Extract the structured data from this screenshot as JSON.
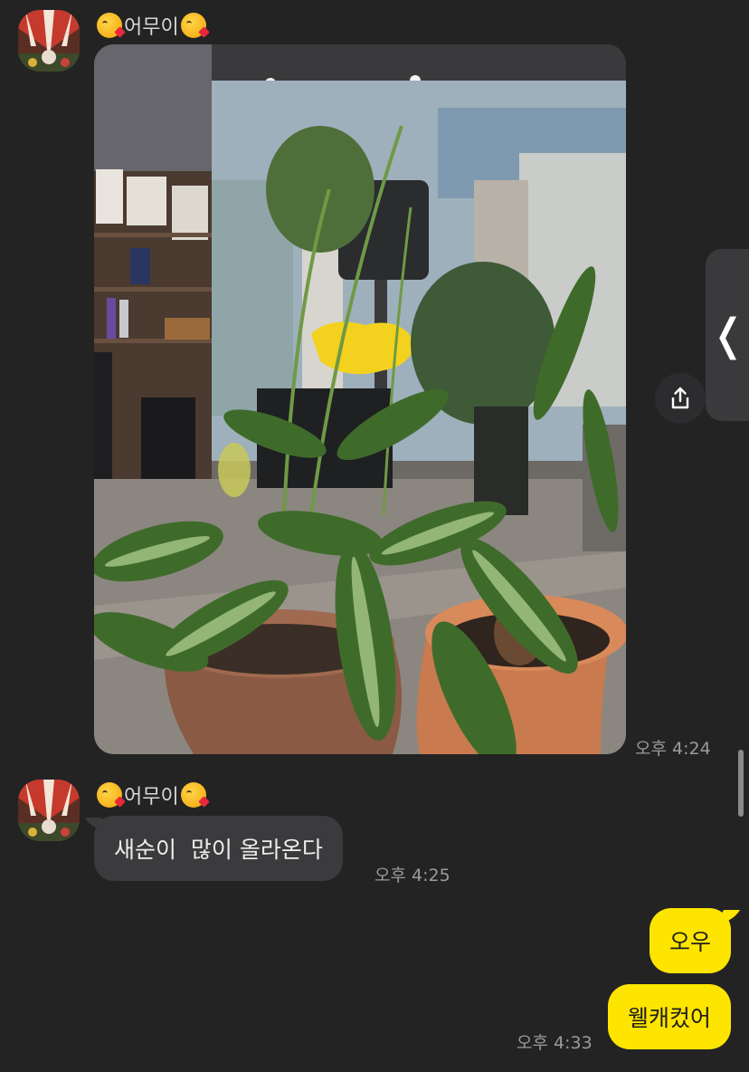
{
  "colors": {
    "background": "#232324",
    "incoming_bubble": "#3b3b3d",
    "outgoing_bubble": "#fee500",
    "timestamp": "#9a9a9a"
  },
  "messages": [
    {
      "type": "photo",
      "sender": "어무이",
      "sender_emoji": "kissing-face-emoji",
      "time": "오후 4:24"
    },
    {
      "type": "text",
      "sender": "어무이",
      "sender_emoji": "kissing-face-emoji",
      "text": "새순이  많이 올라온다",
      "time": "오후 4:25"
    }
  ],
  "my_messages": [
    {
      "text": "오우"
    },
    {
      "text": "웰캐컸어",
      "time": "오후 4:33"
    }
  ],
  "controls": {
    "share_icon": "share-icon",
    "side_panel_icon": "chevron-left-icon",
    "side_panel_glyph": "❬"
  }
}
